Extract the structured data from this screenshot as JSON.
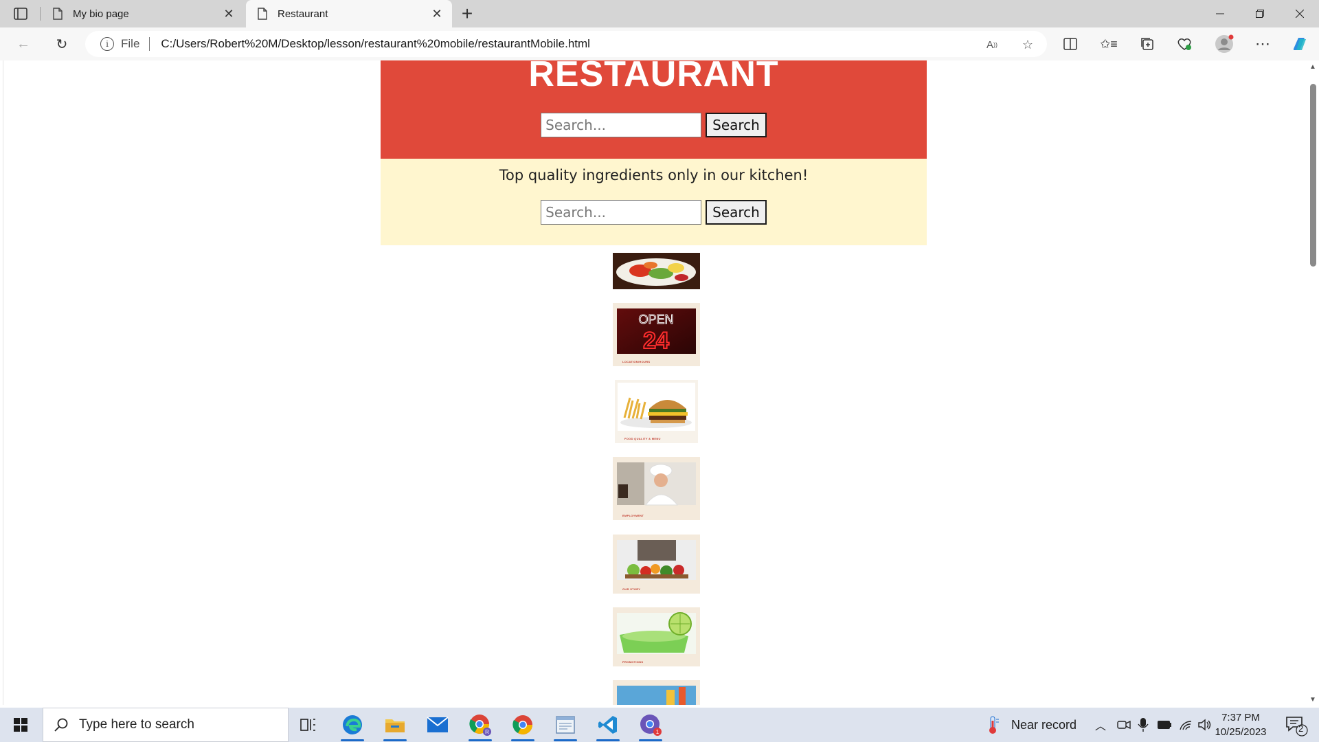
{
  "browser": {
    "tabs": [
      {
        "title": "My bio page",
        "active": false
      },
      {
        "title": "Restaurant",
        "active": true
      }
    ],
    "address": {
      "scheme_label": "File",
      "url": "C:/Users/Robert%20M/Desktop/lesson/restaurant%20mobile/restaurantMobile.html"
    }
  },
  "page": {
    "hero": {
      "title": "RESTAURANT",
      "search_placeholder": "Search...",
      "search_button": "Search"
    },
    "promo": {
      "tagline": "Top quality ingredients only in our kitchen!",
      "search_placeholder": "Search...",
      "search_button": "Search"
    },
    "gallery": [
      {
        "subject": "salad",
        "caption": ""
      },
      {
        "subject": "open-24-neon-sign",
        "caption": "LOCATION/HOURS"
      },
      {
        "subject": "burger-and-fries",
        "caption": "FOOD QUALITY & MENU"
      },
      {
        "subject": "chef",
        "caption": "EMPLOYMENT"
      },
      {
        "subject": "vegetables",
        "caption": "OUR STORY"
      },
      {
        "subject": "lime-drink",
        "caption": "PROMOTIONS"
      },
      {
        "subject": "drinks",
        "caption": ""
      }
    ]
  },
  "taskbar": {
    "search_placeholder": "Type here to search",
    "weather_text": "Near record",
    "time": "7:37 PM",
    "date": "10/25/2023",
    "notification_count": "2",
    "colors": {
      "accent": "#1b6ac9",
      "hero_red": "#e0493a",
      "promo_cream": "#fff6cf"
    }
  }
}
